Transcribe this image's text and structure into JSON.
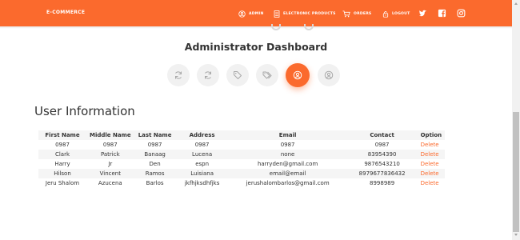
{
  "nav": {
    "brand": "E-COMMERCE",
    "items": [
      {
        "label": "ADMIN",
        "icon": "admin-icon"
      },
      {
        "label": "ELECTRONIC PRODUCTS",
        "icon": "product-icon"
      },
      {
        "label": "ORDERS",
        "icon": "cart-icon"
      },
      {
        "label": "LOGOUT",
        "icon": "logout-icon"
      }
    ],
    "social": [
      "twitter-icon",
      "facebook-icon",
      "instagram-icon"
    ]
  },
  "dashboard": {
    "title": "Administrator Dashboard",
    "icons": [
      "refresh-icon",
      "refresh-icon",
      "tag-icon",
      "tags-icon",
      "user-circle-icon",
      "user-circle-icon"
    ],
    "active_index": 4
  },
  "users": {
    "title": "User Information",
    "columns": [
      "First Name",
      "Middle Name",
      "Last Name",
      "Address",
      "Email",
      "Contact",
      "Option"
    ],
    "rows": [
      [
        "0987",
        "0987",
        "0987",
        "0987",
        "0987",
        "0987",
        "Delete"
      ],
      [
        "Clark",
        "Patrick",
        "Banaag",
        "Lucena",
        "none",
        "83954390",
        "Delete"
      ],
      [
        "Harry",
        "Jr",
        "Den",
        "espn",
        "harryden@gmail.com",
        "9876543210",
        "Delete"
      ],
      [
        "Hilson",
        "Vincent",
        "Ramos",
        "Luisiana",
        "email@email",
        "8979677836432",
        "Delete"
      ],
      [
        "Jeru Shalom",
        "Azucena",
        "Barlos",
        "jkfhjksdhfjks",
        "jerushalombarlos@gmail.com",
        "8998989",
        "Delete"
      ]
    ]
  },
  "colors": {
    "accent": "#fb6a2d",
    "stripe": "#f5f5f5",
    "icon_bg": "#f1f1f1",
    "icon_fg": "#a8a8a8"
  }
}
